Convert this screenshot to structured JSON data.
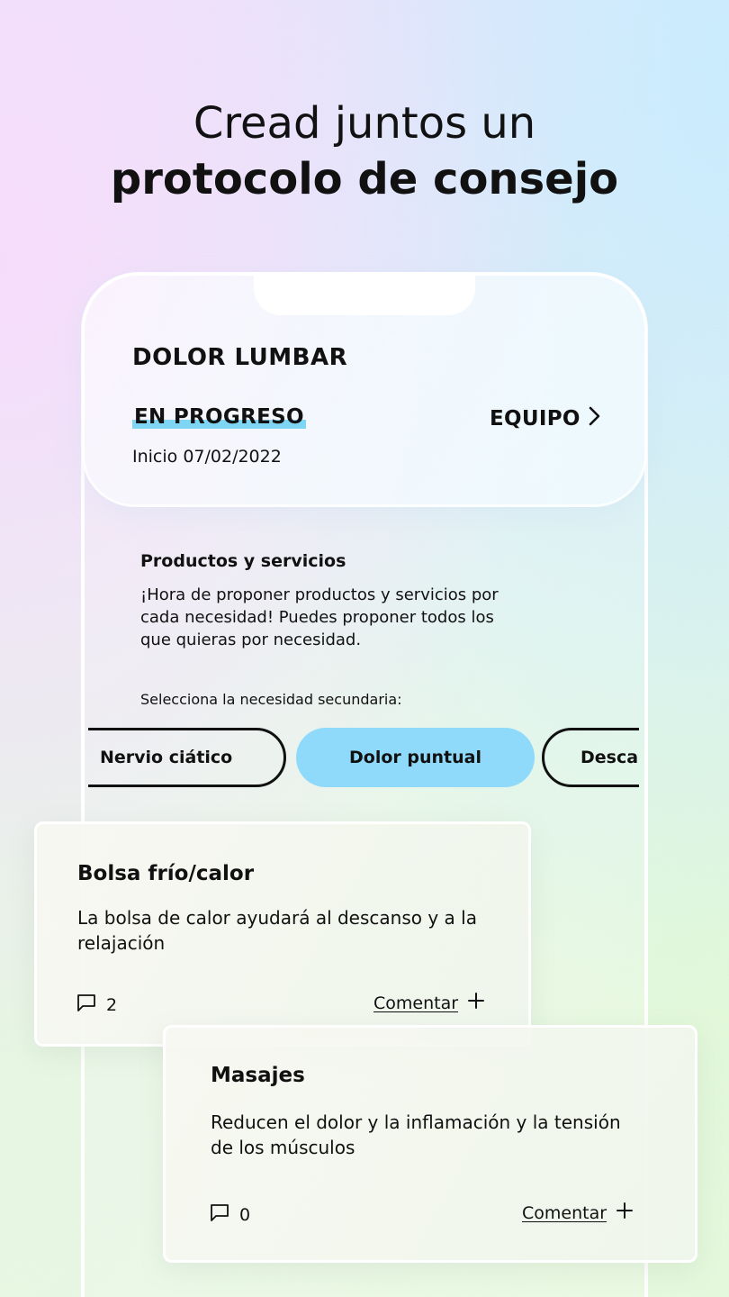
{
  "headline": {
    "line1": "Cread juntos un",
    "line2": "protocolo de consejo"
  },
  "protocol": {
    "title": "DOLOR LUMBAR",
    "status": "EN PROGRESO",
    "team_label": "EQUIPO",
    "start": "Inicio 07/02/2022"
  },
  "section": {
    "title": "Productos y servicios",
    "description": "¡Hora de proponer productos y servicios por cada necesidad! Puedes proponer todos los que quieras por necesidad.",
    "select_label": "Selecciona la necesidad secundaria:"
  },
  "chips": [
    {
      "label": "Nervio ciático",
      "selected": false
    },
    {
      "label": "Dolor puntual",
      "selected": true
    },
    {
      "label": "Desca",
      "selected": false
    }
  ],
  "cards": [
    {
      "title": "Bolsa frío/calor",
      "description": "La bolsa de calor ayudará al descanso y a la relajación",
      "comment_count": "2",
      "comment_label": "Comentar"
    },
    {
      "title": "Masajes",
      "description": "Reducen el dolor y la inflamación y la tensión de los músculos",
      "comment_count": "0",
      "comment_label": "Comentar"
    }
  ],
  "colors": {
    "accent": "#8fdafb",
    "status_highlight": "#7fd6f4",
    "text": "#111111"
  },
  "icons": {
    "team_arrow": "chevron-right-icon",
    "comments": "comment-bubble-icon",
    "add": "plus-icon"
  }
}
